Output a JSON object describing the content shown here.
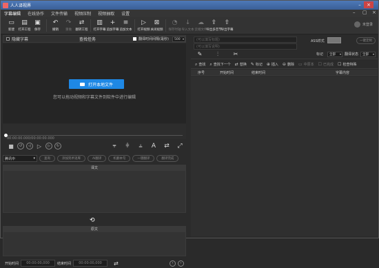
{
  "window": {
    "title": "人人译视界"
  },
  "menu": [
    "字幕编辑",
    "在线协作",
    "文件传输",
    "视频压制",
    "视频抽取",
    "设置"
  ],
  "toolbar": [
    {
      "label": "新建",
      "icon": "new-file-icon",
      "glyph": "▭",
      "enabled": true
    },
    {
      "label": "打开工程",
      "icon": "open-project-icon",
      "glyph": "▤",
      "enabled": true
    },
    {
      "label": "保存",
      "icon": "save-icon",
      "glyph": "▣",
      "enabled": true
    },
    {
      "label": "撤销",
      "icon": "undo-icon",
      "glyph": "↶",
      "enabled": true
    },
    {
      "label": "重做",
      "icon": "redo-icon",
      "glyph": "↷",
      "enabled": false
    },
    {
      "label": "翻转工程",
      "icon": "flip-project-icon",
      "glyph": "⇄",
      "enabled": true
    },
    {
      "label": "打开字幕",
      "icon": "open-subtitle-icon",
      "glyph": "▥",
      "enabled": true
    },
    {
      "label": "追加字幕",
      "icon": "append-subtitle-icon",
      "glyph": "+",
      "enabled": true
    },
    {
      "label": "追加文本",
      "icon": "append-text-icon",
      "glyph": "≡",
      "enabled": true
    },
    {
      "label": "打开视频",
      "icon": "open-video-icon",
      "glyph": "▷",
      "enabled": true
    },
    {
      "label": "关闭视频",
      "icon": "close-video-icon",
      "glyph": "⊠",
      "enabled": true
    },
    {
      "label": "保存时轴",
      "icon": "save-timeline-icon",
      "glyph": "◔",
      "enabled": false
    },
    {
      "label": "导入文本",
      "icon": "import-text-icon",
      "glyph": "↓",
      "enabled": false
    },
    {
      "label": "云端文件",
      "icon": "cloud-file-icon",
      "glyph": "☁",
      "enabled": false
    },
    {
      "label": "导出多音节",
      "icon": "export-multi-icon",
      "glyph": "⇪",
      "enabled": true
    },
    {
      "label": "导出字幕",
      "icon": "export-subtitle-icon",
      "glyph": "⇧",
      "enabled": true
    }
  ],
  "user": {
    "name": "未登录"
  },
  "player": {
    "hide_subtitle": "隐藏字幕",
    "mode": "查找任务",
    "shift_time_label": "翻译时间间隔(毫秒)",
    "shift_time_value": "500",
    "open_button": "打开本地文件",
    "hint": "您可以拖动视频和字幕文件到软件中进行编辑",
    "timecode": "00:00:00.000/00:00:00.000"
  },
  "translate": {
    "engine": "腾讯中",
    "options": [
      "查询",
      "添加到术语库",
      "AI翻译",
      "机翻本句",
      "一键翻译",
      "翻译完成"
    ],
    "translation_header": "译文",
    "original_header": "原文"
  },
  "time": {
    "start_label": "开始时间",
    "start_value": "00:00:00,000",
    "end_label": "结束时间",
    "end_value": "00:00:00,000"
  },
  "right": {
    "title_placeholder": "(可以填写标题)",
    "desc_placeholder": "(可以填写说明)",
    "ass_label": "ASS样式",
    "onekey": "一键定制",
    "mark_label": "标记",
    "all1": "全部",
    "translate_state": "翻译状态",
    "all2": "全部",
    "filters": [
      {
        "label": "查找",
        "g": "⌕",
        "enabled": true
      },
      {
        "label": "查找下一个",
        "g": "⌕",
        "enabled": true
      },
      {
        "label": "替换",
        "g": "⇄",
        "enabled": true
      },
      {
        "label": "标记",
        "g": "✎",
        "enabled": true
      },
      {
        "label": "插入",
        "g": "⊕",
        "enabled": true
      },
      {
        "label": "删除",
        "g": "⊖",
        "enabled": true
      },
      {
        "label": "中原本",
        "g": "▭",
        "enabled": false
      },
      {
        "label": "已完成",
        "g": "☐",
        "enabled": false
      },
      {
        "label": "检查特殊",
        "g": "☐",
        "enabled": true
      }
    ],
    "columns": [
      "序号",
      "开始时间",
      "结束时间",
      "字幕内容"
    ]
  }
}
